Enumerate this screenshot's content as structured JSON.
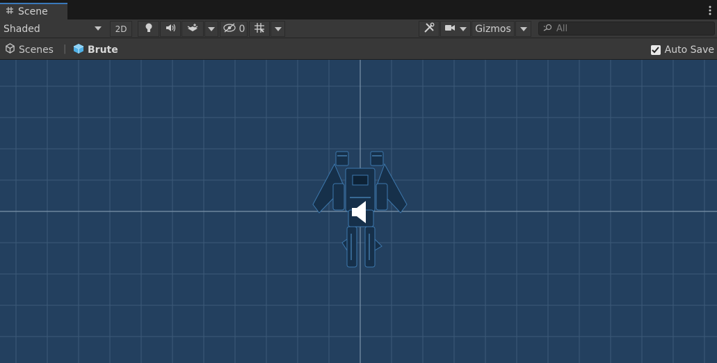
{
  "tab": {
    "label": "Scene"
  },
  "toolbar": {
    "draw_mode": "Shaded",
    "toggle_2d": "2D",
    "hidden_count": "0",
    "gizmos_label": "Gizmos",
    "search_placeholder": "All"
  },
  "breadcrumb": {
    "root": "Scenes",
    "prefab": "Brute"
  },
  "auto_save": {
    "label": "Auto Save",
    "checked": true
  },
  "colors": {
    "viewport_bg": "#23405f",
    "tab_accent": "#3a79bb",
    "prefab_icon": "#5bb5e8"
  },
  "icons": [
    "grid-icon",
    "kebab-menu-icon",
    "lightbulb-icon",
    "audio-icon",
    "effects-icon",
    "visibility-icon",
    "grid-snap-icon",
    "tools-icon",
    "camera-icon",
    "search-icon",
    "unity-logo-icon",
    "prefab-cube-icon",
    "checkmark-icon",
    "audio-source-gizmo-icon"
  ]
}
